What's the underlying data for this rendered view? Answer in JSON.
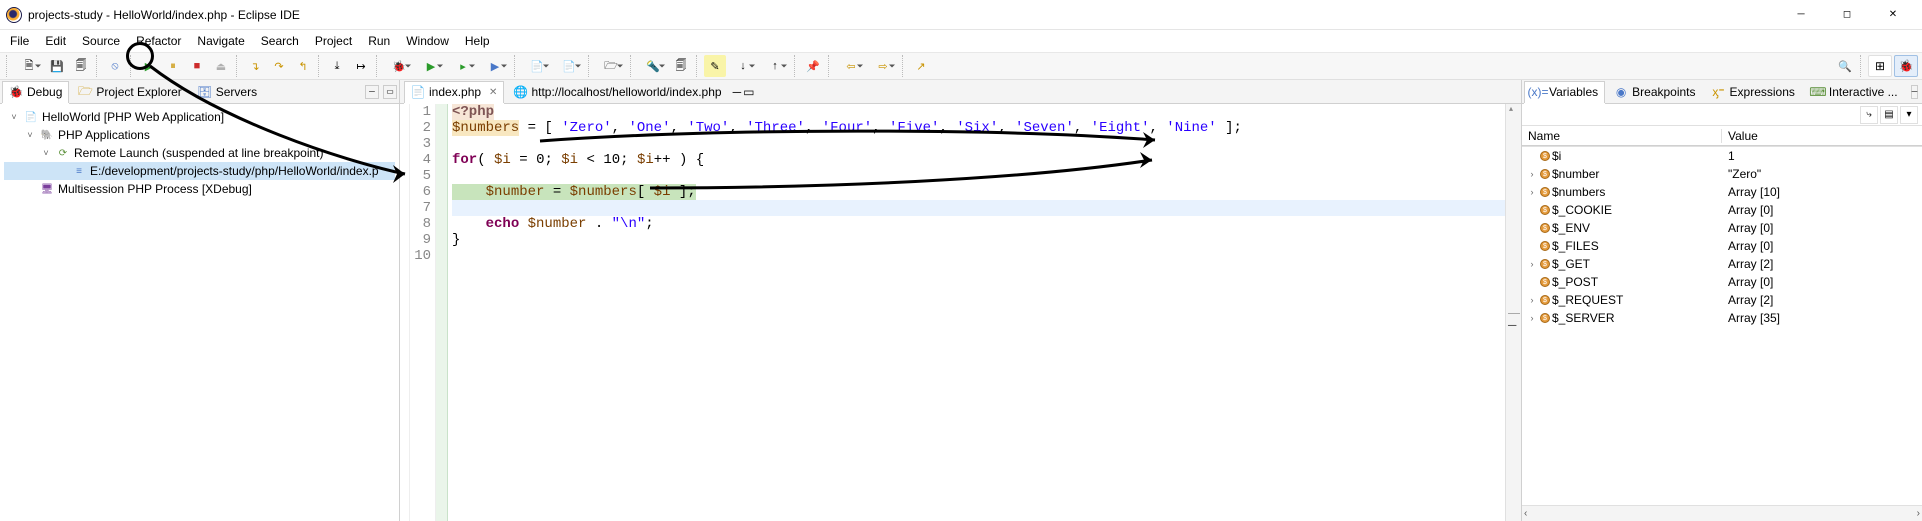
{
  "window": {
    "title": "projects-study - HelloWorld/index.php - Eclipse IDE"
  },
  "menu": {
    "file": "File",
    "edit": "Edit",
    "source": "Source",
    "refactor": "Refactor",
    "navigate": "Navigate",
    "search": "Search",
    "project": "Project",
    "run": "Run",
    "window": "Window",
    "help": "Help"
  },
  "leftPanel": {
    "tabDebug": "Debug",
    "tabProjectExplorer": "Project Explorer",
    "tabServers": "Servers",
    "tree": {
      "root": "HelloWorld [PHP Web Application]",
      "phpApps": "PHP Applications",
      "remoteLaunch": "Remote Launch (suspended at line breakpoint)",
      "stackFrame": "E:/development/projects-study/php/HelloWorld/index.p",
      "multisession": "Multisession PHP Process [XDebug]"
    }
  },
  "editor": {
    "tabIndex": "index.php",
    "tabBrowser": "http://localhost/helloworld/index.php",
    "lines": {
      "l1a": "<?php",
      "l2a": "$numbers",
      "l2b": " = [ ",
      "l2c": "'Zero'",
      "l2d": ", ",
      "l2e": "'One'",
      "l2f": ", ",
      "l2g": "'Two'",
      "l2h": ", ",
      "l2i": "'Three'",
      "l2j": ", ",
      "l2k": "'Four'",
      "l2l": ", ",
      "l2m": "'Five'",
      "l2n": ", ",
      "l2o": "'Six'",
      "l2p": ", ",
      "l2q": "'Seven'",
      "l2r": ", ",
      "l2s": "'Eight'",
      "l2t": ", ",
      "l2u": "'Nine'",
      "l2v": " ];",
      "l4a": "for",
      "l4b": "( ",
      "l4c": "$i",
      "l4d": " = ",
      "l4e": "0",
      "l4f": "; ",
      "l4g": "$i",
      "l4h": " < ",
      "l4i": "10",
      "l4j": "; ",
      "l4k": "$i",
      "l4l": "++ ) {",
      "l6a": "    ",
      "l6b": "$number",
      "l6c": " = ",
      "l6d": "$numbers",
      "l6e": "[ ",
      "l6f": "$i",
      "l6g": " ];",
      "l8a": "    ",
      "l8b": "echo",
      "l8c": " ",
      "l8d": "$number",
      "l8e": " . ",
      "l8f": "\"\\n\"",
      "l8g": ";",
      "l9a": "}"
    },
    "lineNumbers": [
      "1",
      "2",
      "3",
      "4",
      "5",
      "6",
      "7",
      "8",
      "9",
      "10"
    ]
  },
  "rightPanel": {
    "tabVariables": "Variables",
    "tabBreakpoints": "Breakpoints",
    "tabExpressions": "Expressions",
    "tabInteractive": "Interactive ...",
    "header": {
      "name": "Name",
      "value": "Value"
    },
    "rows": [
      {
        "expand": "",
        "name": "$i",
        "value": "1"
      },
      {
        "expand": ">",
        "name": "$number",
        "value": "\"Zero\""
      },
      {
        "expand": ">",
        "name": "$numbers",
        "value": "Array [10]"
      },
      {
        "expand": "",
        "name": "$_COOKIE",
        "value": "Array [0]"
      },
      {
        "expand": "",
        "name": "$_ENV",
        "value": "Array [0]"
      },
      {
        "expand": "",
        "name": "$_FILES",
        "value": "Array [0]"
      },
      {
        "expand": ">",
        "name": "$_GET",
        "value": "Array [2]"
      },
      {
        "expand": "",
        "name": "$_POST",
        "value": "Array [0]"
      },
      {
        "expand": ">",
        "name": "$_REQUEST",
        "value": "Array [2]"
      },
      {
        "expand": ">",
        "name": "$_SERVER",
        "value": "Array [35]"
      }
    ]
  }
}
